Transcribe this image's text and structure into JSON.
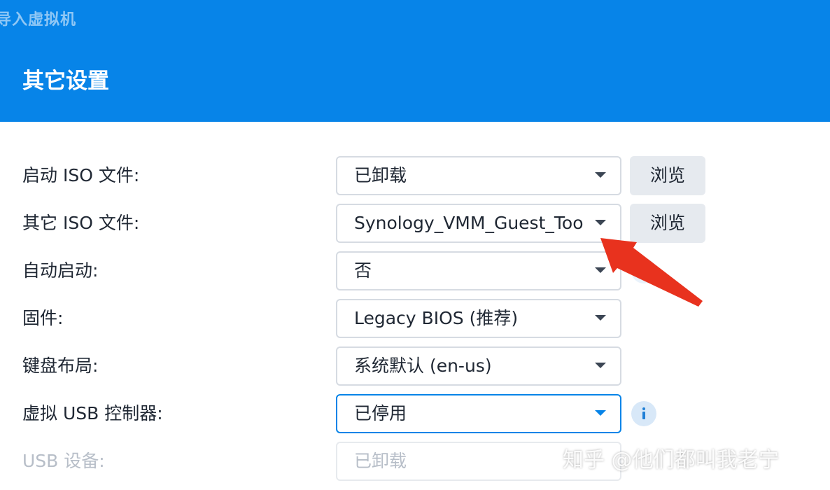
{
  "window": {
    "title": "导入虚拟机"
  },
  "section": {
    "title": "其它设置"
  },
  "form": {
    "boot_iso": {
      "label": "启动 ISO 文件:",
      "value": "已卸载",
      "button": "浏览"
    },
    "other_iso": {
      "label": "其它 ISO 文件:",
      "value": "Synology_VMM_Guest_Tool",
      "button": "浏览"
    },
    "autostart": {
      "label": "自动启动:",
      "value": "否"
    },
    "firmware": {
      "label": "固件:",
      "value": "Legacy BIOS (推荐)"
    },
    "keyboard": {
      "label": "键盘布局:",
      "value": "系统默认 (en-us)"
    },
    "usb_controller": {
      "label": "虚拟 USB 控制器:",
      "value": "已停用"
    },
    "usb_device": {
      "label": "USB 设备:",
      "value": "已卸载"
    }
  },
  "watermark": {
    "text": "知乎 @他们都叫我老宁"
  },
  "colors": {
    "header": "#0784e8",
    "focus_border": "#0784e8",
    "annotation_arrow": "#e8321e"
  },
  "icons": {
    "dropdown": "chevron-down-icon",
    "info": "info-icon",
    "annotation": "red-arrow-annotation"
  }
}
